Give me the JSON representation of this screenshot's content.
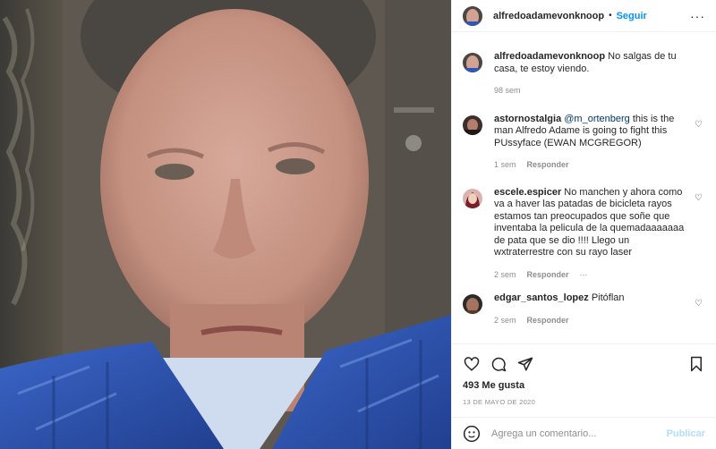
{
  "post": {
    "author": "alfredoadamevonknoop",
    "separator": "•",
    "follow_label": "Seguir",
    "more_label": "···",
    "caption_text": "No salgas de tu casa, te estoy viendo.",
    "caption_age": "98 sem",
    "likes": "493 Me gusta",
    "date": "13 DE MAYO DE 2020"
  },
  "comments": [
    {
      "user": "astornostalgia",
      "mention": "@m_ortenberg",
      "text": " this is the man Alfredo Adame is going to fight this PUssyface (EWAN MCGREGOR)",
      "age": "1 sem",
      "reply": "Responder",
      "more": ""
    },
    {
      "user": "escele.espicer",
      "mention": "",
      "text": "No manchen y ahora como va a haver las patadas de bicicleta rayos estamos tan preocupados que soñe que inventaba la pelicula de la quemadaaaaaaa de pata que se dio !!!! Llego un wxtraterrestre con su rayo laser",
      "age": "2 sem",
      "reply": "Responder",
      "more": "···"
    },
    {
      "user": "edgar_santos_lopez",
      "mention": "",
      "text": "Pitóflan",
      "age": "2 sem",
      "reply": "Responder",
      "more": ""
    }
  ],
  "comment_box": {
    "placeholder": "Agrega un comentario...",
    "post_label": "Publicar"
  },
  "icons": {
    "heart": "heart-icon",
    "comment": "comment-icon",
    "share": "paper-plane-icon",
    "save": "bookmark-icon",
    "emoji": "smiley-icon"
  },
  "colors": {
    "link": "#0095f6",
    "mention": "#00376b",
    "muted": "#8e8e8e",
    "post_disabled": "#b2dffc",
    "suit": "#2f56b8"
  }
}
